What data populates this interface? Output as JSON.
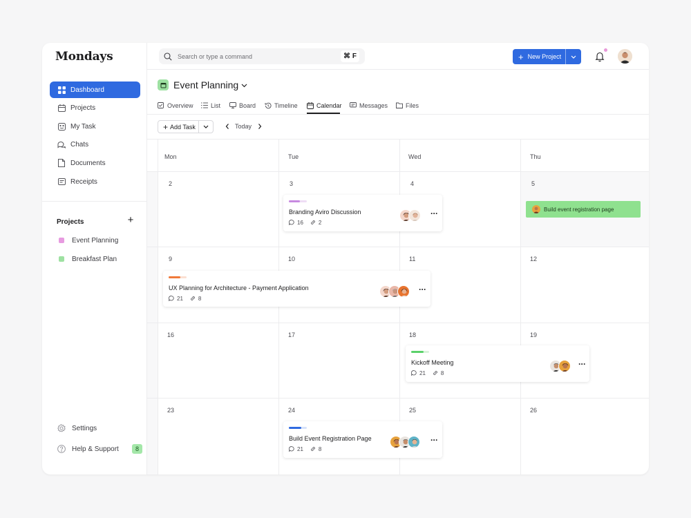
{
  "app": {
    "logo": "Mondays"
  },
  "sidebar": {
    "items": [
      {
        "label": "Dashboard",
        "icon": "grid-icon",
        "active": true
      },
      {
        "label": "Projects",
        "icon": "calendar-icon",
        "active": false
      },
      {
        "label": "My Task",
        "icon": "task-icon",
        "active": false
      },
      {
        "label": "Chats",
        "icon": "chat-icon",
        "active": false
      },
      {
        "label": "Documents",
        "icon": "document-icon",
        "active": false
      },
      {
        "label": "Receipts",
        "icon": "receipt-icon",
        "active": false
      }
    ],
    "projects_title": "Projects",
    "projects": [
      {
        "label": "Event Planning",
        "color": "#e79be0"
      },
      {
        "label": "Breakfast Plan",
        "color": "#9ee1a2"
      }
    ],
    "settings_label": "Settings",
    "help_label": "Help & Support",
    "help_badge": "8"
  },
  "topbar": {
    "search_placeholder": "Search or type a command",
    "shortcut": "⌘ F",
    "new_project_label": "New Project"
  },
  "page": {
    "title": "Event Planning",
    "tabs": [
      {
        "label": "Overview",
        "icon": "checkbox-icon"
      },
      {
        "label": "List",
        "icon": "list-icon"
      },
      {
        "label": "Board",
        "icon": "board-icon"
      },
      {
        "label": "Timeline",
        "icon": "history-icon"
      },
      {
        "label": "Calendar",
        "icon": "calendar-icon",
        "active": true
      },
      {
        "label": "Messages",
        "icon": "message-icon"
      },
      {
        "label": "Files",
        "icon": "folder-icon"
      }
    ],
    "add_task_label": "Add Task",
    "today_label": "Today"
  },
  "calendar": {
    "days": [
      "Mon",
      "Tue",
      "Wed",
      "Thu"
    ],
    "weeks": [
      [
        "2",
        "3",
        "4",
        "5"
      ],
      [
        "9",
        "10",
        "11",
        "12"
      ],
      [
        "16",
        "17",
        "18",
        "19"
      ],
      [
        "23",
        "24",
        "25",
        "26"
      ]
    ],
    "events": [
      {
        "title": "Branding Aviro Discussion",
        "comments": "16",
        "links": "2",
        "color": "#c78ae0",
        "progress": 0.6
      },
      {
        "title": "UX Planning for Architecture - Payment Application",
        "comments": "21",
        "links": "8",
        "color": "#f07a3a",
        "progress": 0.65
      },
      {
        "title": "Kickoff Meeting",
        "comments": "21",
        "links": "8",
        "color": "#5ad16a",
        "progress": 0.7
      },
      {
        "title": "Build Event Registration Page",
        "comments": "21",
        "links": "8",
        "color": "#2f6ae0",
        "progress": 0.7
      }
    ],
    "allday_event": {
      "title": "Build event registration page",
      "color": "#8fe18f"
    }
  },
  "colors": {
    "accent": "#2f6ae0"
  }
}
